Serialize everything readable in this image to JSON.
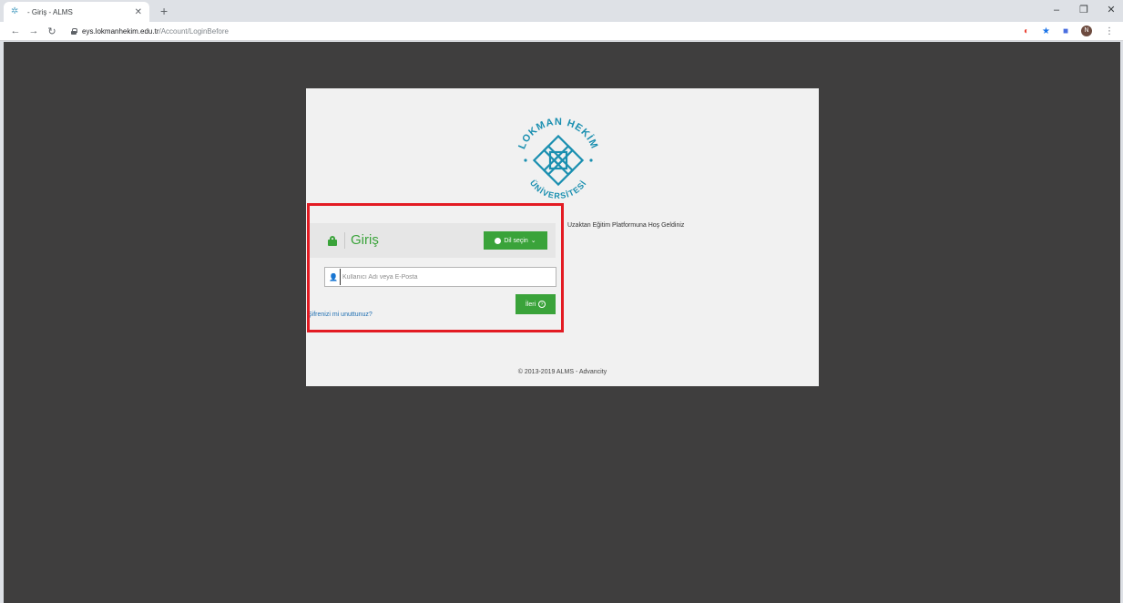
{
  "browser": {
    "tab_title": "- Giriş - ALMS",
    "url_host": "eys.lokmanhekim.edu.tr",
    "url_path": "/Account/LoginBefore",
    "avatar_letter": "N",
    "window_controls": {
      "minimize": "–",
      "restore": "❐",
      "close": "✕"
    }
  },
  "logo": {
    "text_top": "LOKMAN HEKİM",
    "text_bottom": "ÜNİVERSİTESİ",
    "color": "#1a8fb0"
  },
  "welcome": "Uzaktan Eğitim Platformuna Hoş Geldiniz",
  "login": {
    "title": "Giriş",
    "language_button": "Dil seçin",
    "username_placeholder": "Kullanıcı Adı veya E-Posta",
    "forgot_password": "Şifrenizi mi unuttunuz?",
    "next_button": "İleri"
  },
  "footer": "© 2013-2019 ALMS - Advancity",
  "colors": {
    "accent_green": "#3aa33a",
    "highlight_red": "#e31b23",
    "page_background": "#3f3e3e"
  }
}
